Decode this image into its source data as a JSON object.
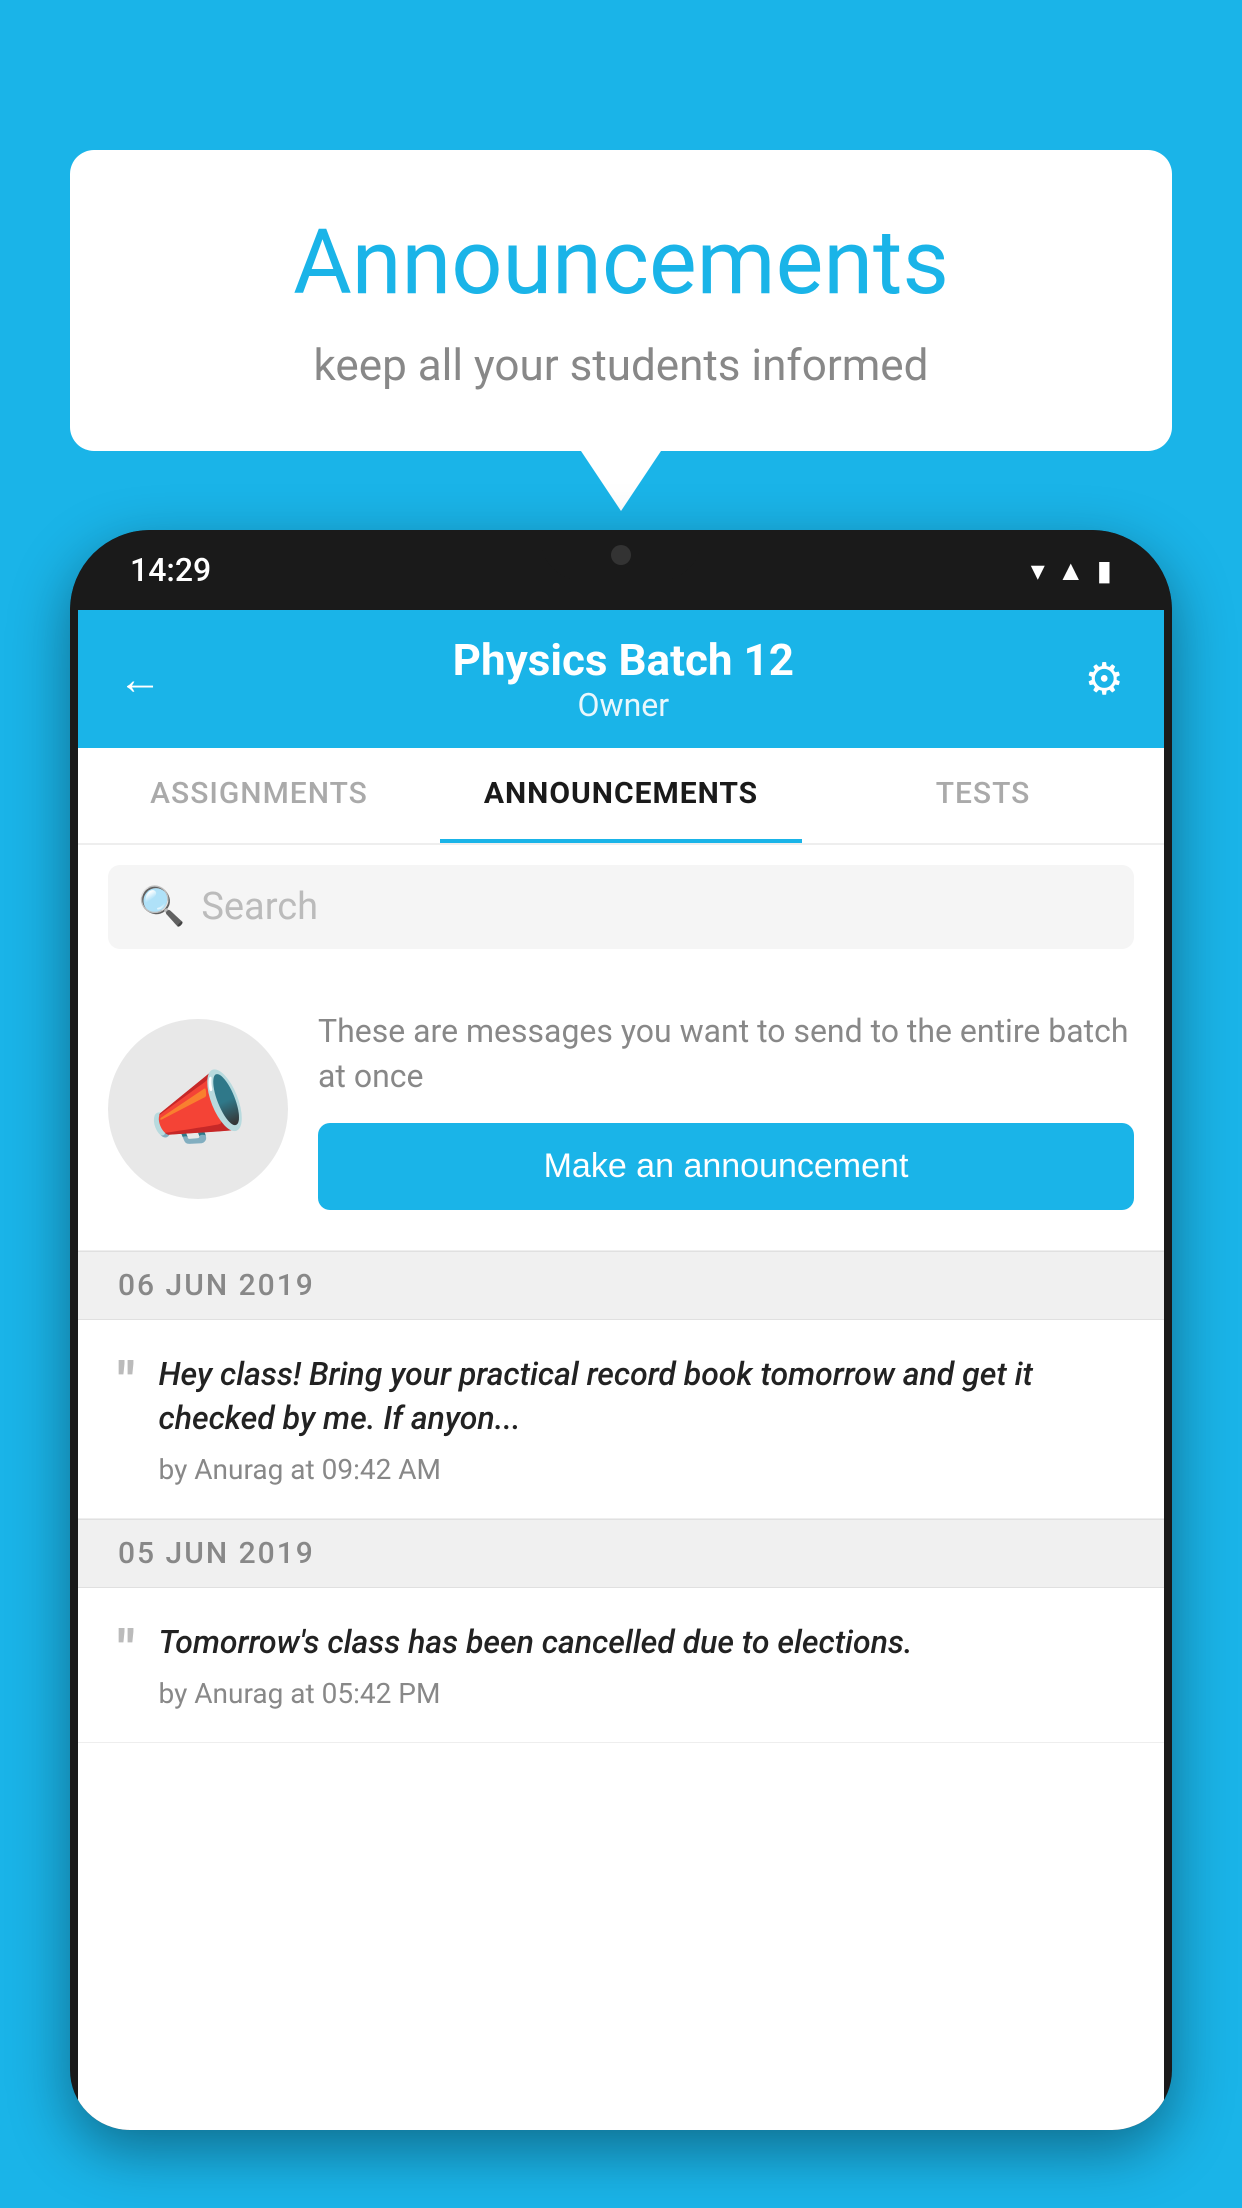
{
  "background": {
    "color": "#1ab4e8"
  },
  "speech_bubble": {
    "title": "Announcements",
    "subtitle": "keep all your students informed"
  },
  "phone": {
    "status_bar": {
      "time": "14:29"
    },
    "header": {
      "title": "Physics Batch 12",
      "subtitle": "Owner",
      "back_label": "←",
      "gear_label": "⚙"
    },
    "tabs": [
      {
        "label": "ASSIGNMENTS",
        "active": false
      },
      {
        "label": "ANNOUNCEMENTS",
        "active": true
      },
      {
        "label": "TESTS",
        "active": false
      }
    ],
    "search": {
      "placeholder": "Search"
    },
    "promo": {
      "description": "These are messages you want to send to the entire batch at once",
      "button_label": "Make an announcement"
    },
    "announcements": [
      {
        "date": "06  JUN  2019",
        "text": "Hey class! Bring your practical record book tomorrow and get it checked by me. If anyon...",
        "author": "by Anurag at 09:42 AM"
      },
      {
        "date": "05  JUN  2019",
        "text": "Tomorrow's class has been cancelled due to elections.",
        "author": "by Anurag at 05:42 PM"
      }
    ]
  }
}
